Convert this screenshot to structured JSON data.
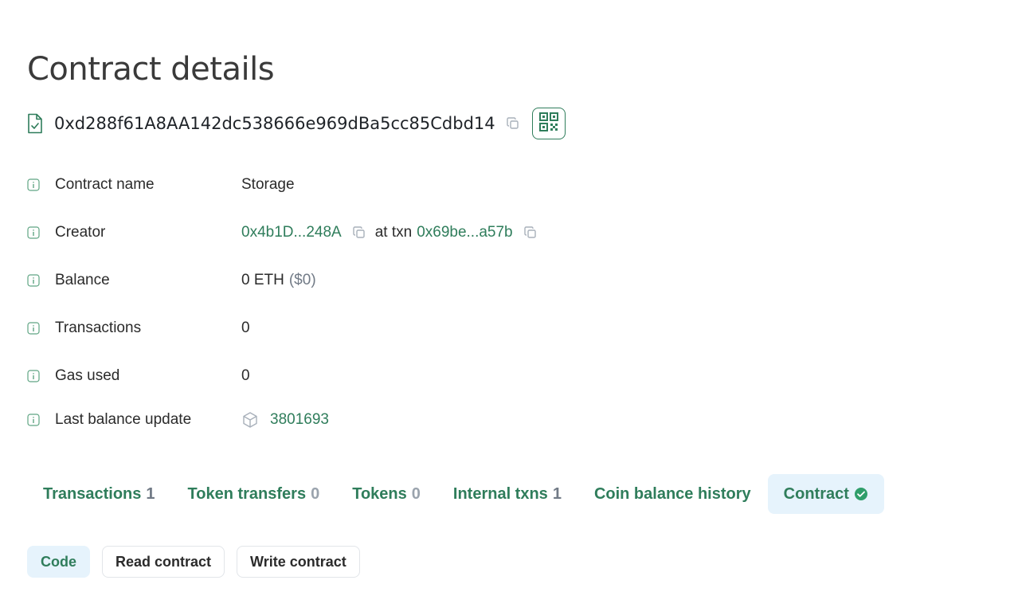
{
  "page": {
    "title": "Contract details"
  },
  "address": {
    "value": "0xd288f61A8AA142dc538666e969dBa5cc85Cdbd14",
    "icon": "contract-file-check-icon",
    "qr_icon": "qr-code-icon"
  },
  "details": [
    {
      "label": "Contract name",
      "value": "Storage"
    },
    {
      "label": "Creator",
      "creator": "0x4b1D...248A",
      "at_txn": "at txn",
      "txn": "0x69be...a57b"
    },
    {
      "label": "Balance",
      "value": "0 ETH",
      "usd": "($0)"
    },
    {
      "label": "Transactions",
      "value": "0"
    },
    {
      "label": "Gas used",
      "value": "0"
    },
    {
      "label": "Last balance update",
      "block": "3801693"
    }
  ],
  "tabs": [
    {
      "label": "Transactions",
      "count": "1"
    },
    {
      "label": "Token transfers",
      "count": "0"
    },
    {
      "label": "Tokens",
      "count": "0"
    },
    {
      "label": "Internal txns",
      "count": "1"
    },
    {
      "label": "Coin balance history"
    },
    {
      "label": "Contract",
      "active": true,
      "verified_icon": "check-circle-icon"
    }
  ],
  "subtabs": [
    {
      "label": "Code",
      "active": true
    },
    {
      "label": "Read contract"
    },
    {
      "label": "Write contract"
    }
  ],
  "colors": {
    "accent": "#2f7d5b",
    "active_bg": "#e6f3fc",
    "muted": "#717a86"
  }
}
